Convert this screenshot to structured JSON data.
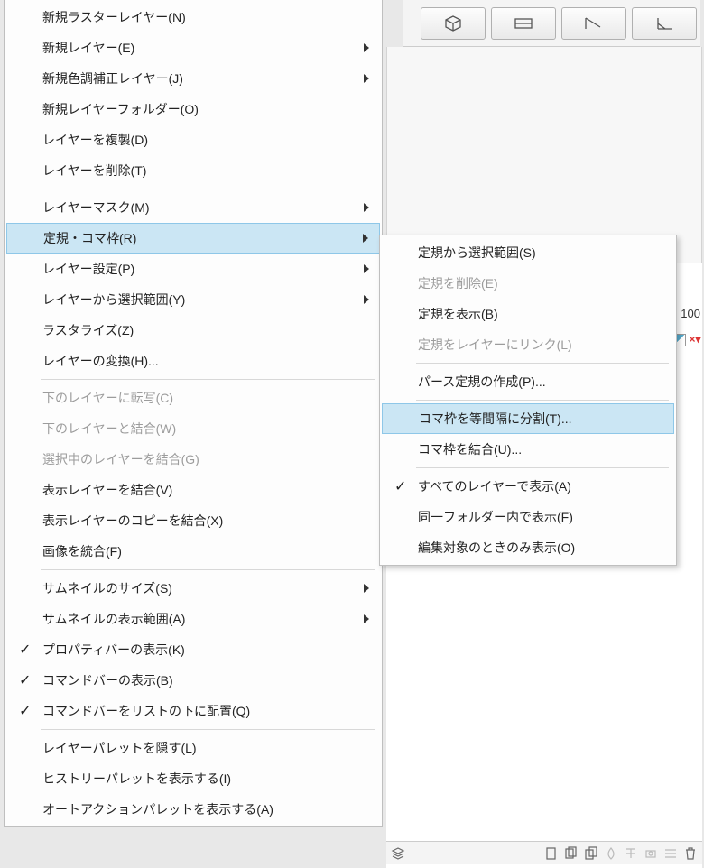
{
  "toolbar_icons": [
    "cube-icon",
    "rect-icon",
    "ruler-icon",
    "angle-icon"
  ],
  "main_menu": {
    "groups": [
      [
        {
          "label": "新規ラスターレイヤー(N)",
          "arrow": false
        },
        {
          "label": "新規レイヤー(E)",
          "arrow": true
        },
        {
          "label": "新規色調補正レイヤー(J)",
          "arrow": true
        },
        {
          "label": "新規レイヤーフォルダー(O)",
          "arrow": false
        },
        {
          "label": "レイヤーを複製(D)",
          "arrow": false
        },
        {
          "label": "レイヤーを削除(T)",
          "arrow": false
        }
      ],
      [
        {
          "label": "レイヤーマスク(M)",
          "arrow": true
        },
        {
          "label": "定規・コマ枠(R)",
          "arrow": true,
          "highlighted": true
        },
        {
          "label": "レイヤー設定(P)",
          "arrow": true
        },
        {
          "label": "レイヤーから選択範囲(Y)",
          "arrow": true
        },
        {
          "label": "ラスタライズ(Z)",
          "arrow": false
        },
        {
          "label": "レイヤーの変換(H)...",
          "arrow": false
        }
      ],
      [
        {
          "label": "下のレイヤーに転写(C)",
          "arrow": false,
          "disabled": true
        },
        {
          "label": "下のレイヤーと結合(W)",
          "arrow": false,
          "disabled": true
        },
        {
          "label": "選択中のレイヤーを結合(G)",
          "arrow": false,
          "disabled": true
        },
        {
          "label": "表示レイヤーを結合(V)",
          "arrow": false
        },
        {
          "label": "表示レイヤーのコピーを結合(X)",
          "arrow": false
        },
        {
          "label": "画像を統合(F)",
          "arrow": false
        }
      ],
      [
        {
          "label": "サムネイルのサイズ(S)",
          "arrow": true
        },
        {
          "label": "サムネイルの表示範囲(A)",
          "arrow": true
        },
        {
          "label": "プロパティバーの表示(K)",
          "arrow": false,
          "checked": true
        },
        {
          "label": "コマンドバーの表示(B)",
          "arrow": false,
          "checked": true
        },
        {
          "label": "コマンドバーをリストの下に配置(Q)",
          "arrow": false,
          "checked": true
        }
      ],
      [
        {
          "label": "レイヤーパレットを隠す(L)",
          "arrow": false
        },
        {
          "label": "ヒストリーパレットを表示する(I)",
          "arrow": false
        },
        {
          "label": "オートアクションパレットを表示する(A)",
          "arrow": false
        }
      ]
    ]
  },
  "submenu": {
    "groups": [
      [
        {
          "label": "定規から選択範囲(S)"
        },
        {
          "label": "定規を削除(E)",
          "disabled": true
        },
        {
          "label": "定規を表示(B)"
        },
        {
          "label": "定規をレイヤーにリンク(L)",
          "disabled": true
        }
      ],
      [
        {
          "label": "パース定規の作成(P)..."
        }
      ],
      [
        {
          "label": "コマ枠を等間隔に分割(T)...",
          "highlighted": true
        },
        {
          "label": "コマ枠を結合(U)..."
        }
      ],
      [
        {
          "label": "すべてのレイヤーで表示(A)",
          "checked": true
        },
        {
          "label": "同一フォルダー内で表示(F)"
        },
        {
          "label": "編集対象のときのみ表示(O)"
        }
      ]
    ]
  },
  "right_panel": {
    "value_100": "100"
  },
  "bottom_icons_left": [
    "layers-icon"
  ],
  "bottom_icons_right": [
    "new-doc-icon",
    "docs-icon",
    "copy-icon",
    "drop-icon",
    "lock-icon",
    "search-icon",
    "lines-icon",
    "trash-icon"
  ]
}
